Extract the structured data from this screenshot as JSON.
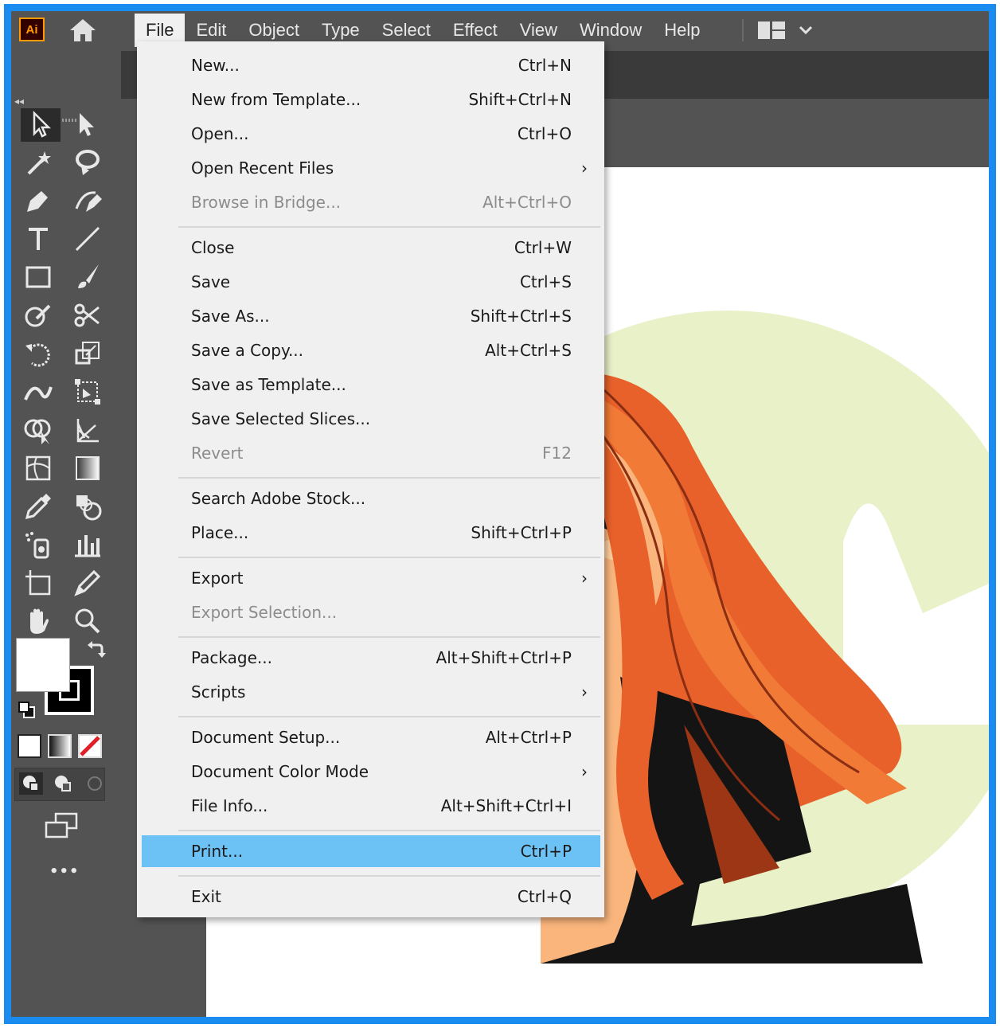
{
  "app": {
    "logo_text": "Ai",
    "accent_color": "#ff9a00",
    "frame_color": "#1a8cf0"
  },
  "menubar": {
    "items": [
      "File",
      "Edit",
      "Object",
      "Type",
      "Select",
      "Effect",
      "View",
      "Window",
      "Help"
    ],
    "active": "File"
  },
  "file_menu": {
    "items": [
      {
        "label": "New...",
        "shortcut": "Ctrl+N"
      },
      {
        "label": "New from Template...",
        "shortcut": "Shift+Ctrl+N"
      },
      {
        "label": "Open...",
        "shortcut": "Ctrl+O"
      },
      {
        "label": "Open Recent Files",
        "submenu": true
      },
      {
        "label": "Browse in Bridge...",
        "shortcut": "Alt+Ctrl+O",
        "disabled": true
      },
      {
        "label": "Close",
        "shortcut": "Ctrl+W"
      },
      {
        "label": "Save",
        "shortcut": "Ctrl+S"
      },
      {
        "label": "Save As...",
        "shortcut": "Shift+Ctrl+S"
      },
      {
        "label": "Save a Copy...",
        "shortcut": "Alt+Ctrl+S"
      },
      {
        "label": "Save as Template..."
      },
      {
        "label": "Save Selected Slices..."
      },
      {
        "label": "Revert",
        "shortcut": "F12",
        "disabled": true
      },
      {
        "label": "Search Adobe Stock..."
      },
      {
        "label": "Place...",
        "shortcut": "Shift+Ctrl+P"
      },
      {
        "label": "Export",
        "submenu": true
      },
      {
        "label": "Export Selection...",
        "disabled": true
      },
      {
        "label": "Package...",
        "shortcut": "Alt+Shift+Ctrl+P"
      },
      {
        "label": "Scripts",
        "submenu": true
      },
      {
        "label": "Document Setup...",
        "shortcut": "Alt+Ctrl+P"
      },
      {
        "label": "Document Color Mode",
        "submenu": true
      },
      {
        "label": "File Info...",
        "shortcut": "Alt+Shift+Ctrl+I"
      },
      {
        "label": "Print...",
        "shortcut": "Ctrl+P",
        "highlighted": true
      },
      {
        "label": "Exit",
        "shortcut": "Ctrl+Q"
      }
    ],
    "highlight_color": "#6dc2f5"
  },
  "toolbar": {
    "more_label": "•••"
  }
}
